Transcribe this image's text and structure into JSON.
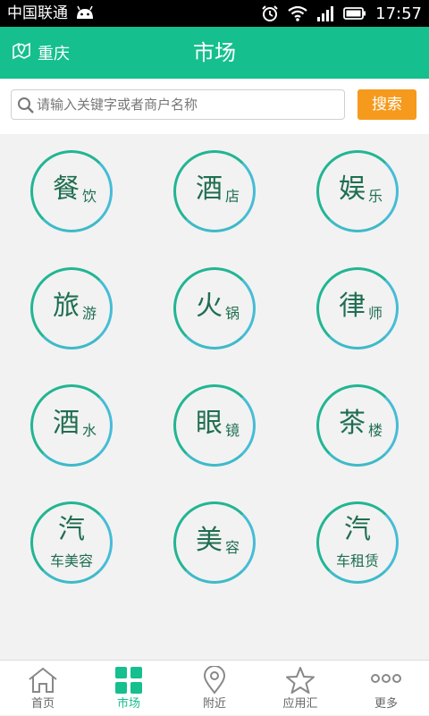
{
  "status_bar": {
    "carrier": "中国联通",
    "time": "17:57"
  },
  "header": {
    "location": "重庆",
    "title": "市场"
  },
  "search": {
    "placeholder": "请输入关键字或者商户名称",
    "value": "",
    "button_label": "搜索"
  },
  "categories": [
    {
      "big": "餐",
      "small": "饮"
    },
    {
      "big": "酒",
      "small": "店"
    },
    {
      "big": "娱",
      "small": "乐"
    },
    {
      "big": "旅",
      "small": "游"
    },
    {
      "big": "火",
      "small": "锅"
    },
    {
      "big": "律",
      "small": "师"
    },
    {
      "big": "酒",
      "small": "水"
    },
    {
      "big": "眼",
      "small": "镜"
    },
    {
      "big": "茶",
      "small": "楼"
    },
    {
      "big": "汽",
      "small": "车美容"
    },
    {
      "big": "美",
      "small": "容"
    },
    {
      "big": "汽",
      "small": "车租赁"
    }
  ],
  "tabs": [
    {
      "label": "首页",
      "icon": "home-icon"
    },
    {
      "label": "市场",
      "icon": "grid-icon",
      "active": true
    },
    {
      "label": "附近",
      "icon": "location-pin-icon"
    },
    {
      "label": "应用汇",
      "icon": "star-icon"
    },
    {
      "label": "更多",
      "icon": "more-dots-icon"
    }
  ],
  "colors": {
    "primary": "#15bf8e",
    "search_button": "#f59a1c",
    "circle_green": "#22b593",
    "circle_blue": "#46bcd6",
    "category_text": "#1f6e51"
  }
}
